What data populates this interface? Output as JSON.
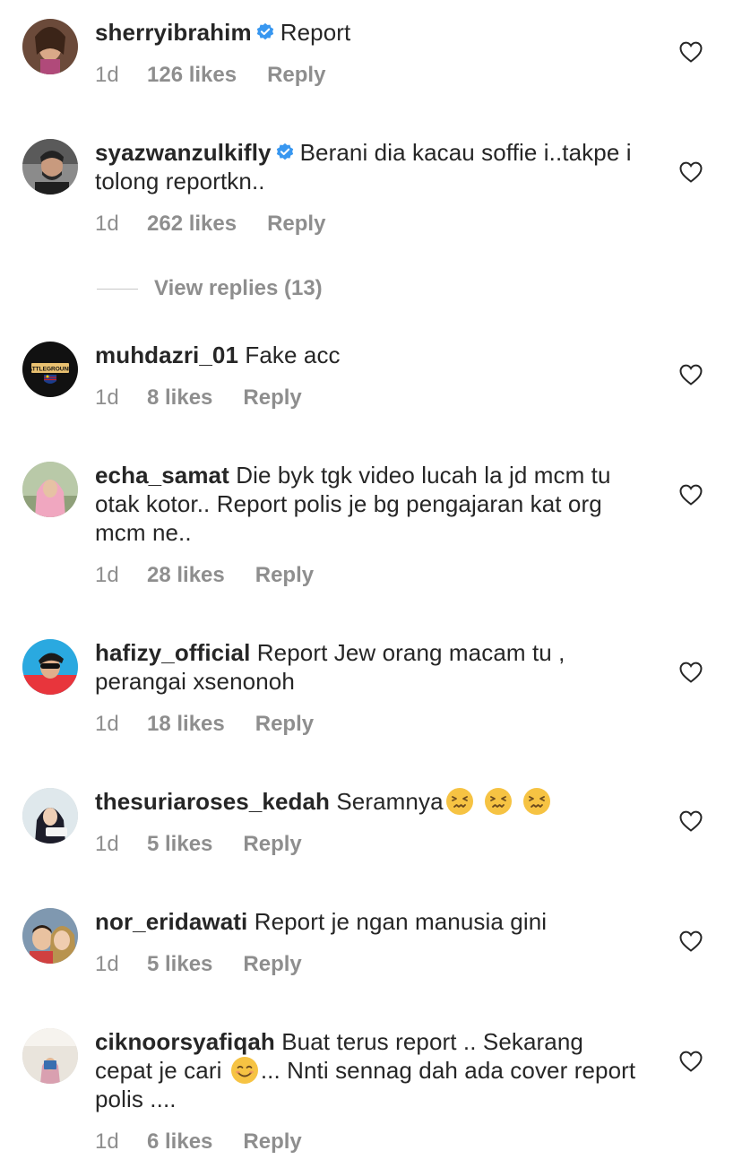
{
  "comments": [
    {
      "username": "sherryibrahim",
      "verified": true,
      "text": "Report",
      "time": "1d",
      "likes": "126 likes",
      "reply": "Reply"
    },
    {
      "username": "syazwanzulkifly",
      "verified": true,
      "text": "Berani dia kacau soffie i..takpe i tolong reportkn..",
      "time": "1d",
      "likes": "262 likes",
      "reply": "Reply"
    },
    {
      "username": "muhdazri_01",
      "verified": false,
      "text": "Fake acc",
      "time": "1d",
      "likes": "8 likes",
      "reply": "Reply"
    },
    {
      "username": "echa_samat",
      "verified": false,
      "text": "Die byk tgk video lucah la jd mcm tu otak kotor.. Report polis je bg pengajaran kat org mcm ne..",
      "time": "1d",
      "likes": "28 likes",
      "reply": "Reply"
    },
    {
      "username": "hafizy_official",
      "verified": false,
      "text": "Report Jew orang macam tu , perangai xsenonoh",
      "time": "1d",
      "likes": "18 likes",
      "reply": "Reply"
    },
    {
      "username": "thesuriaroses_kedah",
      "verified": false,
      "text": "Seramnya",
      "time": "1d",
      "likes": "5 likes",
      "reply": "Reply"
    },
    {
      "username": "nor_eridawati",
      "verified": false,
      "text": "Report je ngan manusia gini",
      "time": "1d",
      "likes": "5 likes",
      "reply": "Reply"
    },
    {
      "username": "ciknoorsyafiqah",
      "verified": false,
      "text_before_emoji": "Buat terus report .. Sekarang cepat je cari",
      "text_after_emoji": "... Nnti sennag dah ada cover report polis ....",
      "time": "1d",
      "likes": "6 likes",
      "reply": "Reply"
    }
  ],
  "view_replies": "View replies (13)",
  "avatar_badge_text": "BATTLEGROUNDS",
  "colors": {
    "text": "#262626",
    "meta": "#8e8e8e",
    "verified_badge": "#3897f0",
    "emoji_face": "#f6c343"
  },
  "icons": {
    "heart": "heart-outline-icon",
    "verified": "verified-badge-icon",
    "emoji_confounded": "confounded-face-emoji",
    "emoji_smile": "smiling-face-emoji"
  }
}
